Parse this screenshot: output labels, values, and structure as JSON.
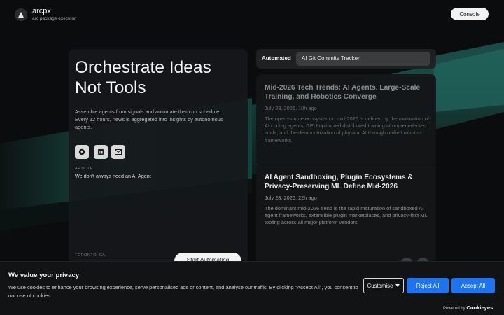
{
  "brand": {
    "name": "arcpx",
    "subtitle": "arc package executor",
    "logo_icon": "arc-triangle-icon"
  },
  "header": {
    "console_label": "Console"
  },
  "hero": {
    "title": "Orchestrate Ideas\nNot Tools",
    "description": "Assemble agents from signals and automate them on schedule. Every 12 hours, news is aggregated into insights by autonomous agents.",
    "social_icons": [
      "github-icon",
      "linkedin-icon",
      "email-icon"
    ],
    "article_label": "ARTICLE",
    "article_link": "We don't always need an AI Agent",
    "location": "TORONTO, CA",
    "cta_label": "Start Automating"
  },
  "feed": {
    "tab_label": "Automated",
    "search_value": "AI Git Commits Tracker",
    "posts": [
      {
        "title": "Mid-2026 Tech Trends: AI Agents, Large-Scale Training, and Robotics Converge",
        "date": "July 28, 2026, 10h ago",
        "body": "The open-source ecosystem in mid-2026 is defined by the maturation of AI coding agents, GPU-optimized distributed training at unprecedented scale, and the democratization of physical AI through unified robotics frameworks."
      },
      {
        "title": "AI Agent Sandboxing, Plugin Ecosystems & Privacy-Preserving ML Define Mid-2026",
        "date": "July 28, 2026, 22h ago",
        "body": "The dominant mid-2026 trend is the rapid maturation of sandboxed AI agent frameworks, extensible plugin marketplaces, and privacy-first ML tooling across all major platform vendors."
      }
    ]
  },
  "cookie": {
    "title": "We value your privacy",
    "text": "We use cookies to enhance your browsing experience, serve personalised ads or content, and analyse our traffic. By clicking \"Accept All\", you consent to our use of cookies.",
    "customize_label": "Customise",
    "reject_label": "Reject All",
    "accept_label": "Accept All",
    "powered_by": "Powered by",
    "powered_brand": "Cookieyes"
  },
  "colors": {
    "accent_blue": "#1e73f0",
    "teal_glow": "#1f6f66",
    "background": "#0b0c0d"
  }
}
